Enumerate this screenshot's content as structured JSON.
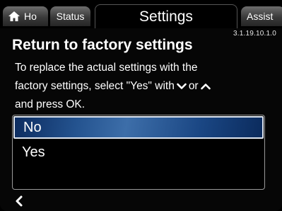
{
  "tabs": {
    "home": "Ho",
    "status": "Status",
    "settings": "Settings",
    "assist": "Assist"
  },
  "version": "3.1.19.10.1.0",
  "page": {
    "title": "Return to factory settings",
    "desc_line1": "To replace the actual settings with the",
    "desc_line2a": "factory settings, select \"Yes\" with",
    "desc_line2b": "or",
    "desc_line3": "and press OK."
  },
  "options": [
    {
      "label": "No",
      "selected": true
    },
    {
      "label": "Yes",
      "selected": false
    }
  ],
  "colors": {
    "background": "#000000",
    "selection": "#2a5a96",
    "text": "#ffffff"
  },
  "icons": {
    "home": "home-icon",
    "down": "chevron-down-icon",
    "up": "chevron-up-icon",
    "back": "back-arrow-icon"
  }
}
